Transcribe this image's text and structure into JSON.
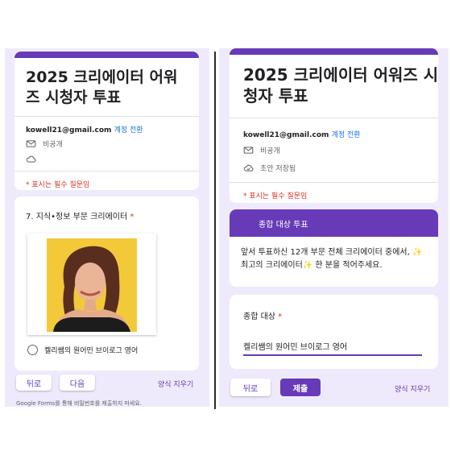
{
  "form": {
    "title": "2025 크리에이터 어워즈 시청자 투표",
    "account_email": "kowell21@gmail.com",
    "switch_account": "계정 전환",
    "not_shared": "비공개",
    "draft_saved": "초안 저장됨",
    "required_note": "* 표시는 필수 질문임"
  },
  "left": {
    "question_title": "7. 지식•정보 부문 크리에이터",
    "required_star": "*",
    "option_label": "켈리쌤의 원어민 브이로그 영어",
    "back_label": "뒤로",
    "next_label": "다음",
    "clear_label": "양식 지우기",
    "footer_note": "Google Forms를 통해 비밀번호를 제출하지 마세요."
  },
  "right": {
    "section_title": "종합 대상 투표",
    "section_desc": "앞서 투표하신 12개 부문 전체 크리에이터 중에서, ✨ 최고의 크리에이터✨ 한 분을 적어주세요.",
    "question_title": "종합 대상",
    "required_star": "*",
    "answer_value": "켈리쌤의 원어민 브이로그 영어",
    "back_label": "뒤로",
    "submit_label": "제출",
    "clear_label": "양식 지우기"
  },
  "colors": {
    "accent": "#673ab7",
    "background": "#efeafb",
    "required": "#d93025",
    "link": "#1a73e8"
  }
}
